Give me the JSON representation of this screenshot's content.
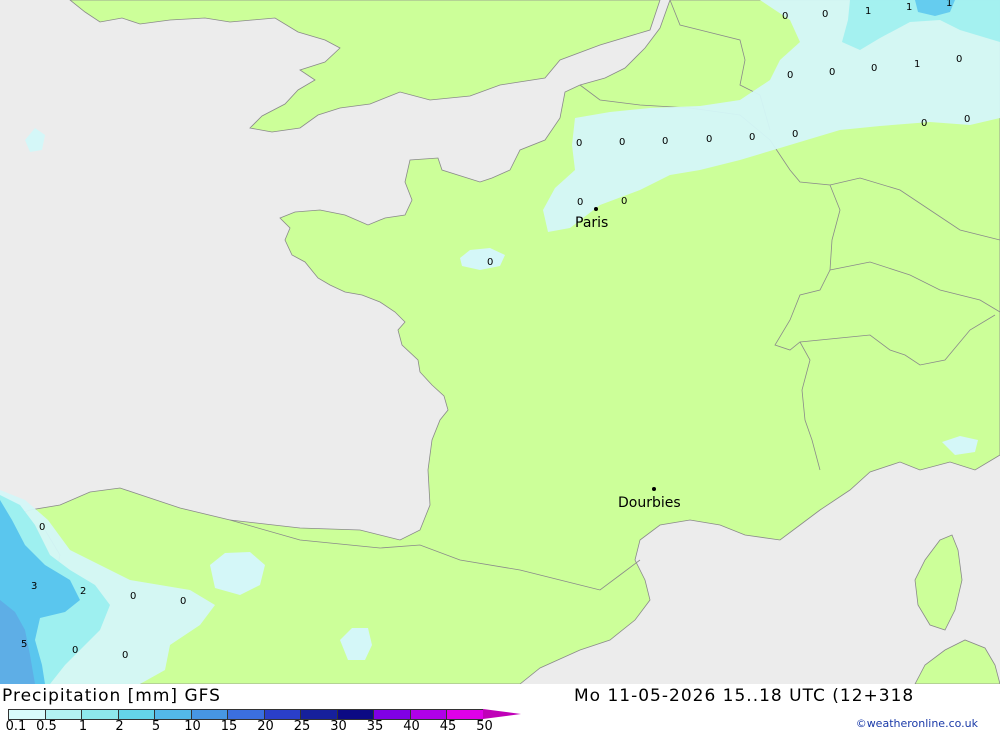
{
  "colors": {
    "sea": "#ececec",
    "land": "#ccff99",
    "precip_light": "#d4f7f8",
    "precip_mid": "#9ef0f0",
    "precip_heavy": "#5ac6ee",
    "precip_strong": "#5eaee6",
    "border": "#8a8a8a"
  },
  "cities": [
    {
      "name": "Paris"
    },
    {
      "name": "Dourbies"
    }
  ],
  "contour_values": [
    "0",
    "0",
    "1",
    "1",
    "1",
    "0",
    "0",
    "0",
    "1",
    "0",
    "0",
    "0",
    "0",
    "0",
    "0",
    "0",
    "0",
    "0",
    "0",
    "0",
    "0",
    "0",
    "3",
    "2",
    "0",
    "0",
    "5",
    "0",
    "0"
  ],
  "footer": {
    "title": "Precipitation [mm] GFS",
    "datetime": "Mo 11-05-2026 15..18 UTC (12+318",
    "credit": "©weatheronline.co.uk"
  },
  "legend": {
    "labels": [
      "0.1",
      "0.5",
      "1",
      "2",
      "5",
      "10",
      "15",
      "20",
      "25",
      "30",
      "35",
      "40",
      "45",
      "50"
    ],
    "colors": [
      "#d9fafa",
      "#b3f2f3",
      "#8ee7ec",
      "#64d4e9",
      "#53b8e8",
      "#4796e3",
      "#3b6fe0",
      "#2a3fc8",
      "#16209c",
      "#0c0a84",
      "#8000e6",
      "#b000e8",
      "#e000e8",
      "#c000b8"
    ]
  }
}
